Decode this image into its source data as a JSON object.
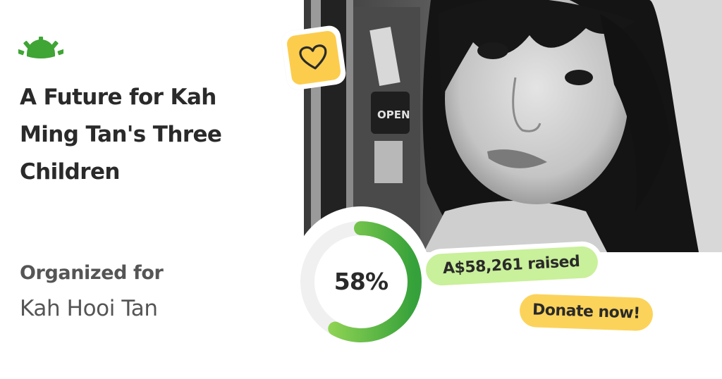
{
  "brand": {
    "logo_icon": "sunrise-logo-icon",
    "color": "#3fa535"
  },
  "campaign": {
    "title": "A Future for Kah Ming Tan's  Three Children",
    "photo_icon": "portrait-photo"
  },
  "organizer": {
    "label": "Organized for",
    "name": "Kah Hooi Tan"
  },
  "progress": {
    "percent_label": "58%",
    "fraction": 0.58,
    "track_color": "#f0f0f0",
    "fill_color_start": "#a6e05a",
    "fill_color_end": "#35a13a"
  },
  "raised": {
    "label": "A$58,261 raised",
    "color": "#c9f09a"
  },
  "cta": {
    "donate_label": "Donate now!",
    "color": "#fcd35a"
  },
  "heart_badge": {
    "icon": "heart-icon",
    "color": "#fccd4d"
  }
}
